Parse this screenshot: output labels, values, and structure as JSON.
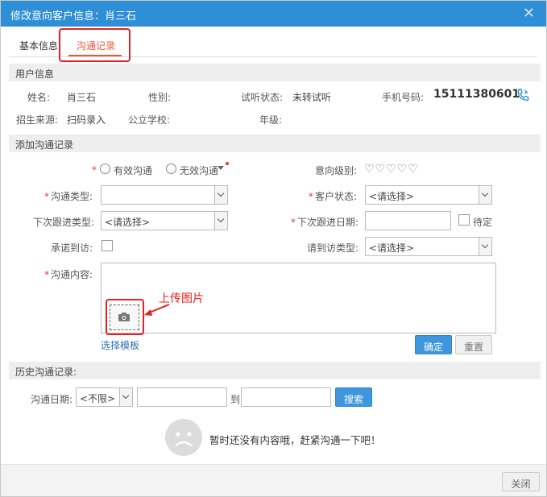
{
  "window": {
    "title": "修改意向客户信息：肖三石"
  },
  "tabs": [
    {
      "label": "基本信息"
    },
    {
      "label": "沟通记录"
    }
  ],
  "user_info": {
    "section": "用户信息",
    "name_label": "姓名:",
    "name": "肖三石",
    "gender_label": "性别:",
    "gender": "",
    "trial_label": "试听状态:",
    "trial": "未转试听",
    "phone_label": "手机号码:",
    "phone": "15111380601",
    "source_label": "招生来源:",
    "source": "扫码录入",
    "school_label": "公立学校:",
    "school": "",
    "grade_label": "年级:",
    "grade": ""
  },
  "add_record": {
    "section": "添加沟通记录",
    "radio_valid": "有效沟通",
    "radio_invalid": "无效沟通",
    "intent_level_label": "意向级别:",
    "hearts": "♡♡♡♡♡",
    "comm_type_label": "沟通类型:",
    "comm_type_value": "",
    "client_status_label": "客户状态:",
    "client_status_value": "<请选择>",
    "next_type_label": "下次跟进类型:",
    "next_type_value": "<请选择>",
    "next_date_label": "下次跟进日期:",
    "next_date_value": "",
    "pending_label": "待定",
    "promise_label": "承诺到访:",
    "invite_type_label": "请到访类型:",
    "invite_type_value": "<请选择>",
    "content_label": "沟通内容:",
    "upload_annotation": "上传图片",
    "template_link": "选择模板",
    "confirm": "确定",
    "reset": "重置"
  },
  "history": {
    "section": "历史沟通记录:",
    "date_label": "沟通日期:",
    "date_range_value": "<不限>",
    "to_label": "到",
    "search": "搜索",
    "empty_text": "暂时还没有内容哦，赶紧沟通一下吧！"
  },
  "footer": {
    "close": "关闭"
  },
  "colors": {
    "titlebar": "#2e8fd6",
    "accent": "#e8593a",
    "primary_button": "#3e97dc",
    "highlight": "#e82020"
  }
}
